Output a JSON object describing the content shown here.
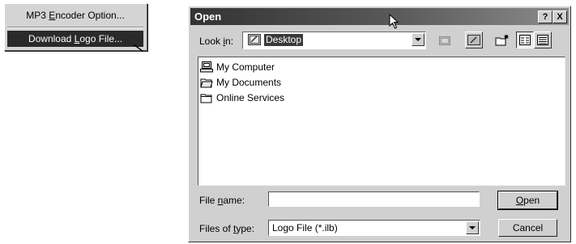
{
  "menu": {
    "items": [
      {
        "pre": "MP3 ",
        "key": "E",
        "post": "ncoder Option..."
      },
      {
        "pre": "Download ",
        "key": "L",
        "post": "ogo File..."
      }
    ]
  },
  "dialog": {
    "title": "Open",
    "help_glyph": "?",
    "close_glyph": "X",
    "look_in": {
      "pre": "Look ",
      "key": "i",
      "post": "n:",
      "value": "Desktop"
    },
    "toolbar": [
      "up-one-level-icon",
      "desktop-icon",
      "new-folder-icon",
      "list-view-icon",
      "details-view-icon"
    ],
    "files": [
      {
        "name": "My Computer",
        "icon": "my-computer-icon"
      },
      {
        "name": "My Documents",
        "icon": "my-documents-icon"
      },
      {
        "name": "Online Services",
        "icon": "folder-icon"
      }
    ],
    "file_name": {
      "pre": "File ",
      "key": "n",
      "post": "ame:",
      "value": ""
    },
    "file_type": {
      "pre": "Files of ",
      "key": "t",
      "post": "ype:",
      "value": "Logo File (*.ilb)"
    },
    "open_button": {
      "pre": "",
      "key": "O",
      "post": "pen"
    },
    "cancel_button": "Cancel"
  }
}
